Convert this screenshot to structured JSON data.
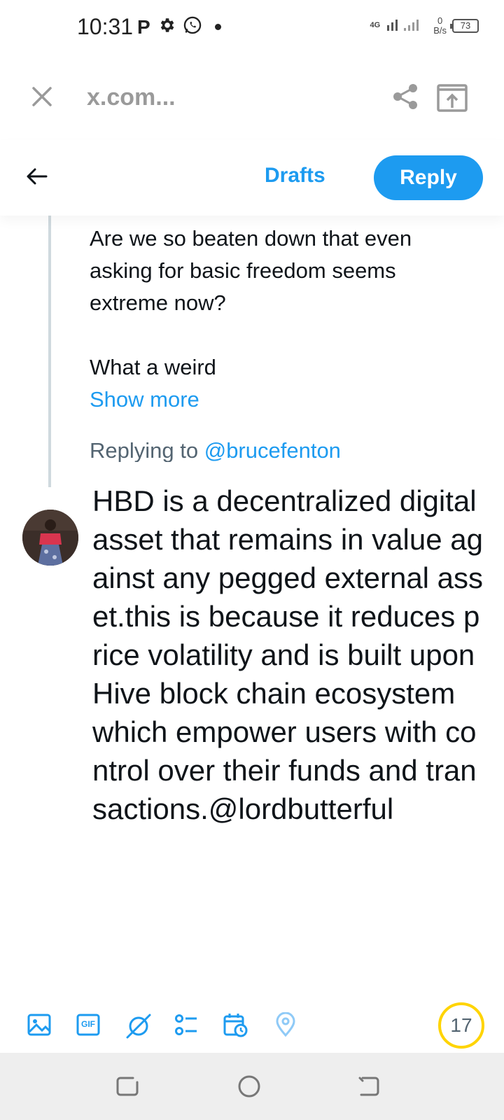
{
  "status_bar": {
    "time": "10:31",
    "p_icon": "P",
    "network": "4G",
    "speed_value": "0",
    "speed_unit": "B/s",
    "battery": "73"
  },
  "browser": {
    "url": "x.com..."
  },
  "compose_header": {
    "drafts_label": "Drafts",
    "reply_label": "Reply"
  },
  "quoted_tweet": {
    "lines": [
      "Are we so beaten down that even",
      "asking for basic freedom seems",
      "extreme now?",
      "What a weird"
    ],
    "show_more": "Show more",
    "replying_prefix": "Replying to ",
    "replying_handle": "@brucefenton"
  },
  "reply_compose": {
    "text": "HBD is a decentralized digital asset that remains in value against any pegged external asset.this is because it reduces price volatility and is built upon Hive block chain ecosystem which empower users with control over their funds and transactions.@lordbutterful"
  },
  "toolbar": {
    "icons": [
      "image-icon",
      "gif-icon",
      "grok-icon",
      "poll-icon",
      "schedule-icon",
      "location-icon"
    ],
    "gif_text": "GIF",
    "char_remaining": "17",
    "accent": "#1d9bf0",
    "counter_color": "#ffd400"
  },
  "colors": {
    "accent": "#1d9bf0",
    "secondary_text": "#536471"
  }
}
